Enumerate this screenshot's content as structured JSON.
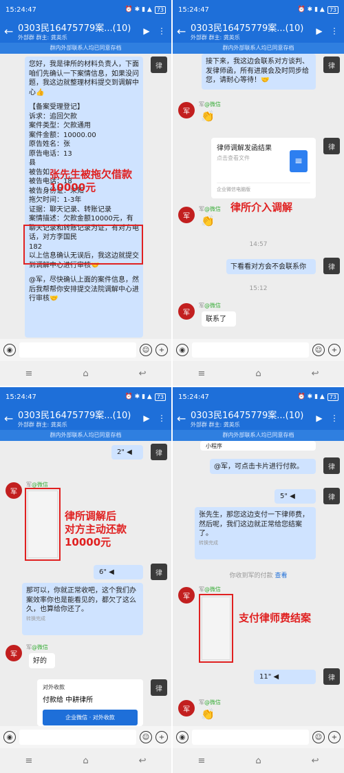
{
  "status_time": "15:24:47",
  "battery": "73",
  "chat_title": "0303民16475779案...(10)",
  "chat_subtitle_left": "外部群",
  "chat_subtitle_right": "群主: 龚英乐",
  "notice": "群内外部联系人均已同意存档",
  "panel1": {
    "msg_intro": "您好，我是律所的材料负责人，下面咱们先确认一下案情信息，如果没问题，我这边就整理材料提交到调解中心👍",
    "form_lines": [
      "【备案受理登记】",
      "诉求：追回欠款",
      "案件类型：欠款通用",
      "案件金额：10000.00",
      "原告姓名：张",
      "原告电话：13",
      "县",
      "被告如",
      "被告电话：18",
      "被告身份证：未知",
      "拖欠时间：1-3年",
      "证据：聊天记录、转账记录",
      "案情描述：欠款金额10000元，有聊天记录和转账记录为证，有对方电话，对方李国民",
      "182"
    ],
    "msg_confirm": "以上信息确认无误后，我这边就提交到调解中心进行审核🤝",
    "msg_notice": "@军，尽快确认上面的案件信息，然后我帮帮你安排提交法院调解中心进行审核🤝",
    "red_label": "张先生被拖欠借款\n10000元"
  },
  "panel2": {
    "msg_top": "接下来，我这边会联系对方谈判、发律师函，所有进展会及时同步给您，请耐心等待！🤝",
    "sender": "军",
    "sender_tag": "@微信",
    "card_title": "律师调解发函结果",
    "card_sub": "点击查看文件",
    "card_foot": "企业微信电脑版",
    "red_label": "律所介入调解",
    "time1": "14:57",
    "msg_lookup": "下看看对方会不会联系你",
    "time2": "15:12",
    "msg_contacted": "联系了"
  },
  "panel3": {
    "voice1": "2\"",
    "sender": "军",
    "sender_tag": "@微信",
    "red_label": "律所调解后\n对方主动还款\n10000元",
    "voice2": "6\"",
    "msg_reply": "那可以，你就正常收吧，这个我们办案效率你也是能看见的，都欠了这么久，也算给你还了。",
    "convert": "转换完成",
    "msg_ok": "好的",
    "pay_header": "对外收款",
    "pay_to": "付款给 中耕律所",
    "pay_btn": "企业微信 · 对外收款"
  },
  "panel4": {
    "mini": "小程序",
    "msg_at": "@军，可点击卡片进行付款。",
    "voice1": "5\"",
    "msg_fee": "张先生，那您这边支付一下律师费，然后呢，我们这边就正常给您结案了。",
    "convert": "转换完成",
    "payment_notice": "你收到军的付款",
    "payment_link": "查看",
    "sender": "军",
    "sender_tag": "@微信",
    "red_label": "支付律师费结案",
    "voice2": "11\""
  }
}
